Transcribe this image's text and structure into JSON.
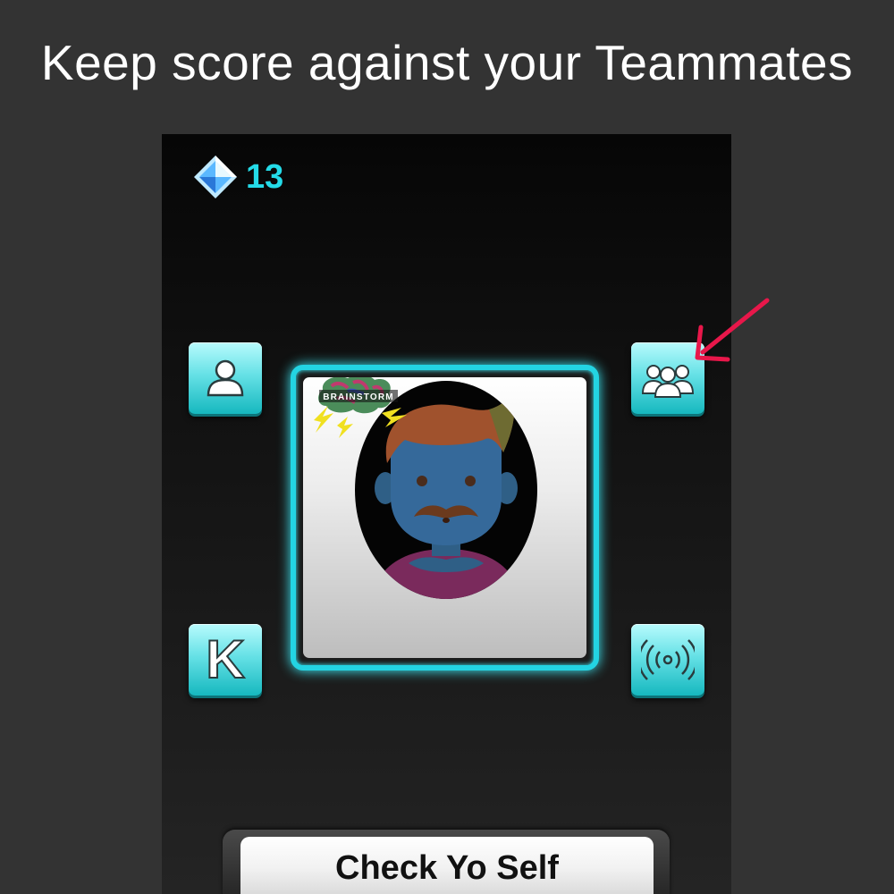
{
  "headline": "Keep score against your Teammates",
  "gems": {
    "count": "13",
    "icon": "diamond-icon",
    "color": "#24dbe8"
  },
  "buttons": {
    "single_player": {
      "icon": "person-icon"
    },
    "teammates": {
      "icon": "group-icon"
    },
    "keyboard": {
      "label": "K"
    },
    "wireless": {
      "icon": "wireless-signal-icon"
    }
  },
  "logo_text": "BRAINSTORM",
  "bottom_button": {
    "label": "Check Yo Self"
  },
  "colors": {
    "accent": "#23d4e3",
    "button": "#66e1e6",
    "arrow": "#e8174a",
    "background": "#333333"
  }
}
